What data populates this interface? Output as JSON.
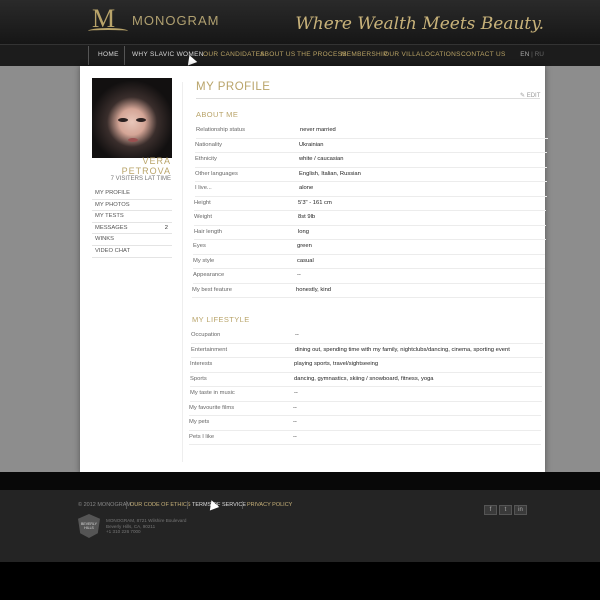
{
  "header": {
    "logo_letter": "M",
    "logo_text": "MONOGRAM",
    "tagline": "Where Wealth Meets Beauty."
  },
  "nav": {
    "items": [
      "HOME",
      "WHY SLAVIC WOMEN",
      "OUR CANDIDATES",
      "ABOUT US",
      "THE PROCESS",
      "MEMBERSHIP",
      "OUR VILLA",
      "LOCATIONS",
      "CONTACT US"
    ],
    "lang_active": "EN",
    "lang_sep": "|",
    "lang_other": "RU"
  },
  "profile": {
    "first_name": "VERA",
    "last_name": "PETROVA",
    "visitors": "7 VISITERS LAT TIME"
  },
  "side_menu": [
    {
      "label": "MY PROFILE",
      "count": ""
    },
    {
      "label": "MY PHOTOS",
      "count": ""
    },
    {
      "label": "MY TESTS",
      "count": ""
    },
    {
      "label": "MESSAGES",
      "count": "2"
    },
    {
      "label": "WINKS",
      "count": ""
    },
    {
      "label": "VIDEO CHAT",
      "count": ""
    }
  ],
  "main": {
    "title": "MY PROFILE",
    "edit_label": "EDIT",
    "about_heading": "ABOUT ME",
    "about": [
      {
        "label": "Relationship status",
        "value": "never married"
      },
      {
        "label": "Nationality",
        "value": "Ukrainian"
      },
      {
        "label": "Ethnicity",
        "value": "white / caucasian"
      },
      {
        "label": "Other languages",
        "value": "English, Italian, Russian"
      },
      {
        "label": "I live...",
        "value": "alone"
      },
      {
        "label": "Height",
        "value": "5'3\" - 161 cm"
      },
      {
        "label": "Weight",
        "value": "8st 9lb"
      },
      {
        "label": "Hair length",
        "value": "long"
      },
      {
        "label": "Eyes",
        "value": "green"
      },
      {
        "label": "My style",
        "value": "casual"
      },
      {
        "label": "Appearance",
        "value": "--"
      },
      {
        "label": "My best feature",
        "value": "honestly, kind"
      }
    ],
    "lifestyle_heading": "MY LIFESTYLE",
    "lifestyle": [
      {
        "label": "Occupation",
        "value": "--"
      },
      {
        "label": "Entertainment",
        "value": "dining out, spending time with my family, nightclubs/dancing, cinema, sporting event"
      },
      {
        "label": "Interests",
        "value": "playing sports, travel/sightseeing"
      },
      {
        "label": "Sports",
        "value": "dancing, gymnastics, skiing / snowboard, fitness, yoga"
      },
      {
        "label": "My taste in music",
        "value": "--"
      },
      {
        "label": "My favourite films",
        "value": "--"
      },
      {
        "label": "My pets",
        "value": "--"
      },
      {
        "label": "Pets I like",
        "value": "--"
      }
    ]
  },
  "footer": {
    "copyright": "© 2012 MONOGRAM",
    "links": [
      "OUR CODE OF ETHICS",
      "TERMS OF SERVICE",
      "PRIVACY POLICY"
    ],
    "badge_text": "BEVERLY HILLS",
    "address_lines": [
      "MONOGRAM, 8721 Wilshire Boulevard",
      "Beverly Hills, CA, 90211",
      "+1 310 226 7000"
    ],
    "social": [
      "f",
      "t",
      "in"
    ]
  }
}
